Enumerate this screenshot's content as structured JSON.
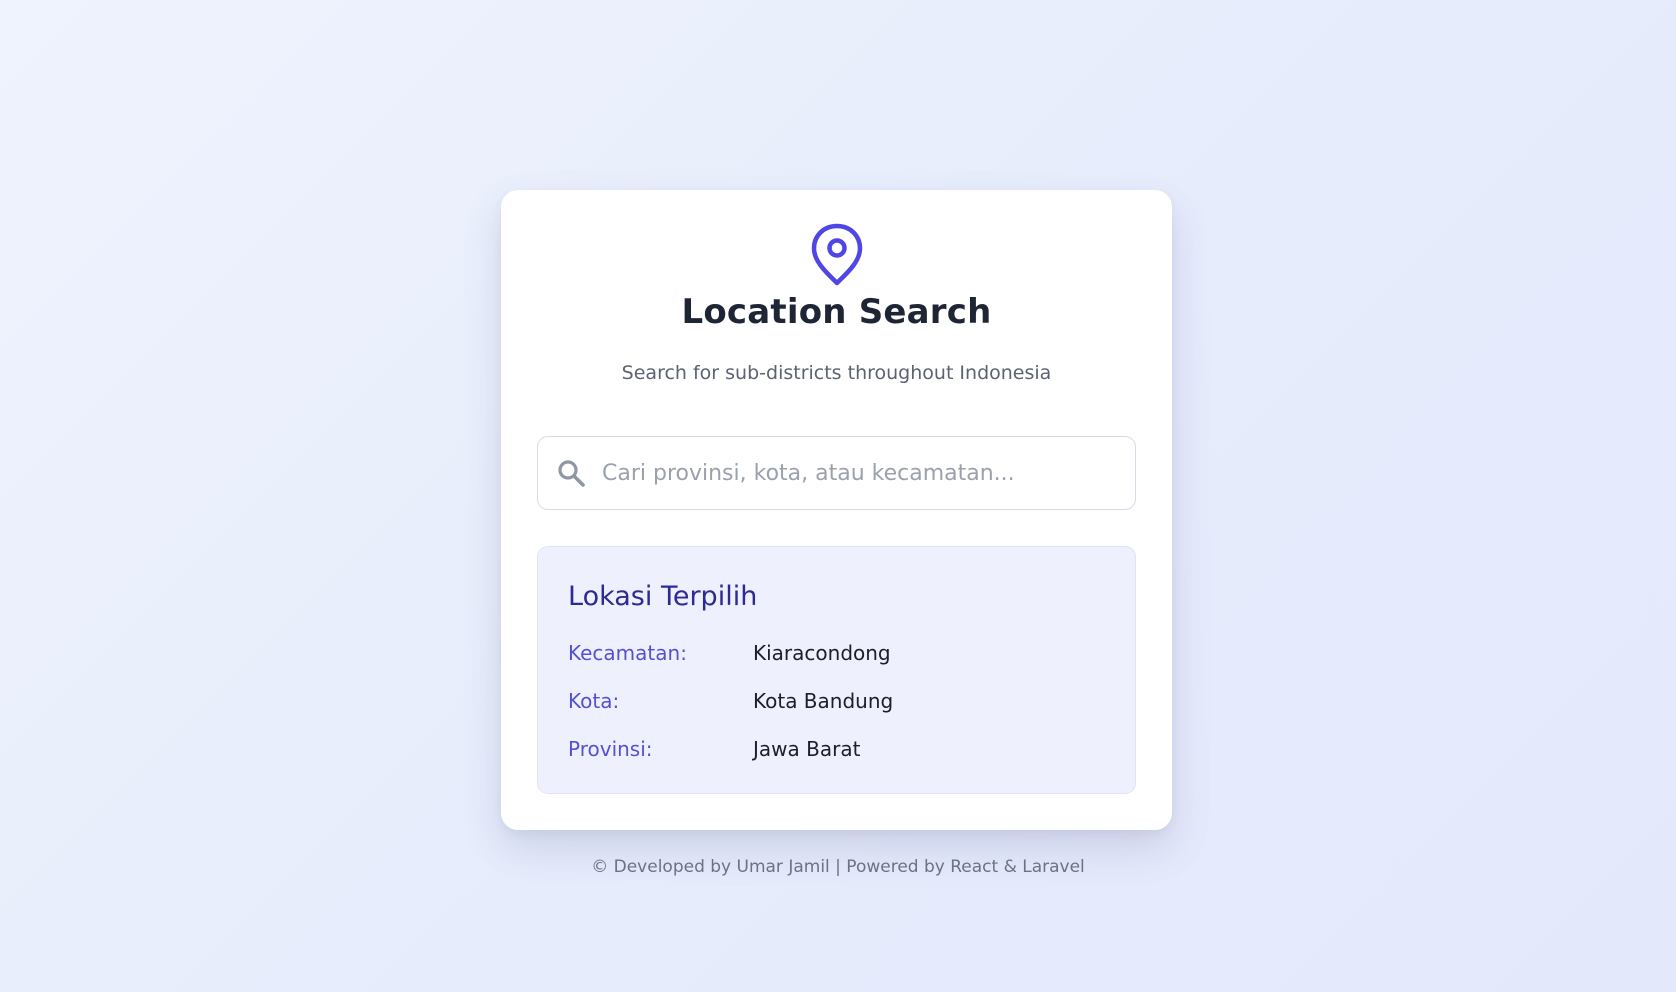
{
  "header": {
    "icon": "map-pin-icon",
    "title": "Location Search",
    "subtitle": "Search for sub-districts throughout Indonesia"
  },
  "search": {
    "icon": "search-icon",
    "placeholder": "Cari provinsi, kota, atau kecamatan...",
    "value": ""
  },
  "selected": {
    "title": "Lokasi Terpilih",
    "rows": [
      {
        "label": "Kecamatan:",
        "value": "Kiaracondong"
      },
      {
        "label": "Kota:",
        "value": "Kota Bandung"
      },
      {
        "label": "Provinsi:",
        "value": "Jawa Barat"
      }
    ]
  },
  "footer": {
    "text": "© Developed by Umar Jamil | Powered by React & Laravel"
  },
  "colors": {
    "accent": "#4f46e5",
    "title": "#1e2535",
    "panel_background": "#eef1fd",
    "label": "#5450d4",
    "panel_title": "#2d2a93"
  }
}
